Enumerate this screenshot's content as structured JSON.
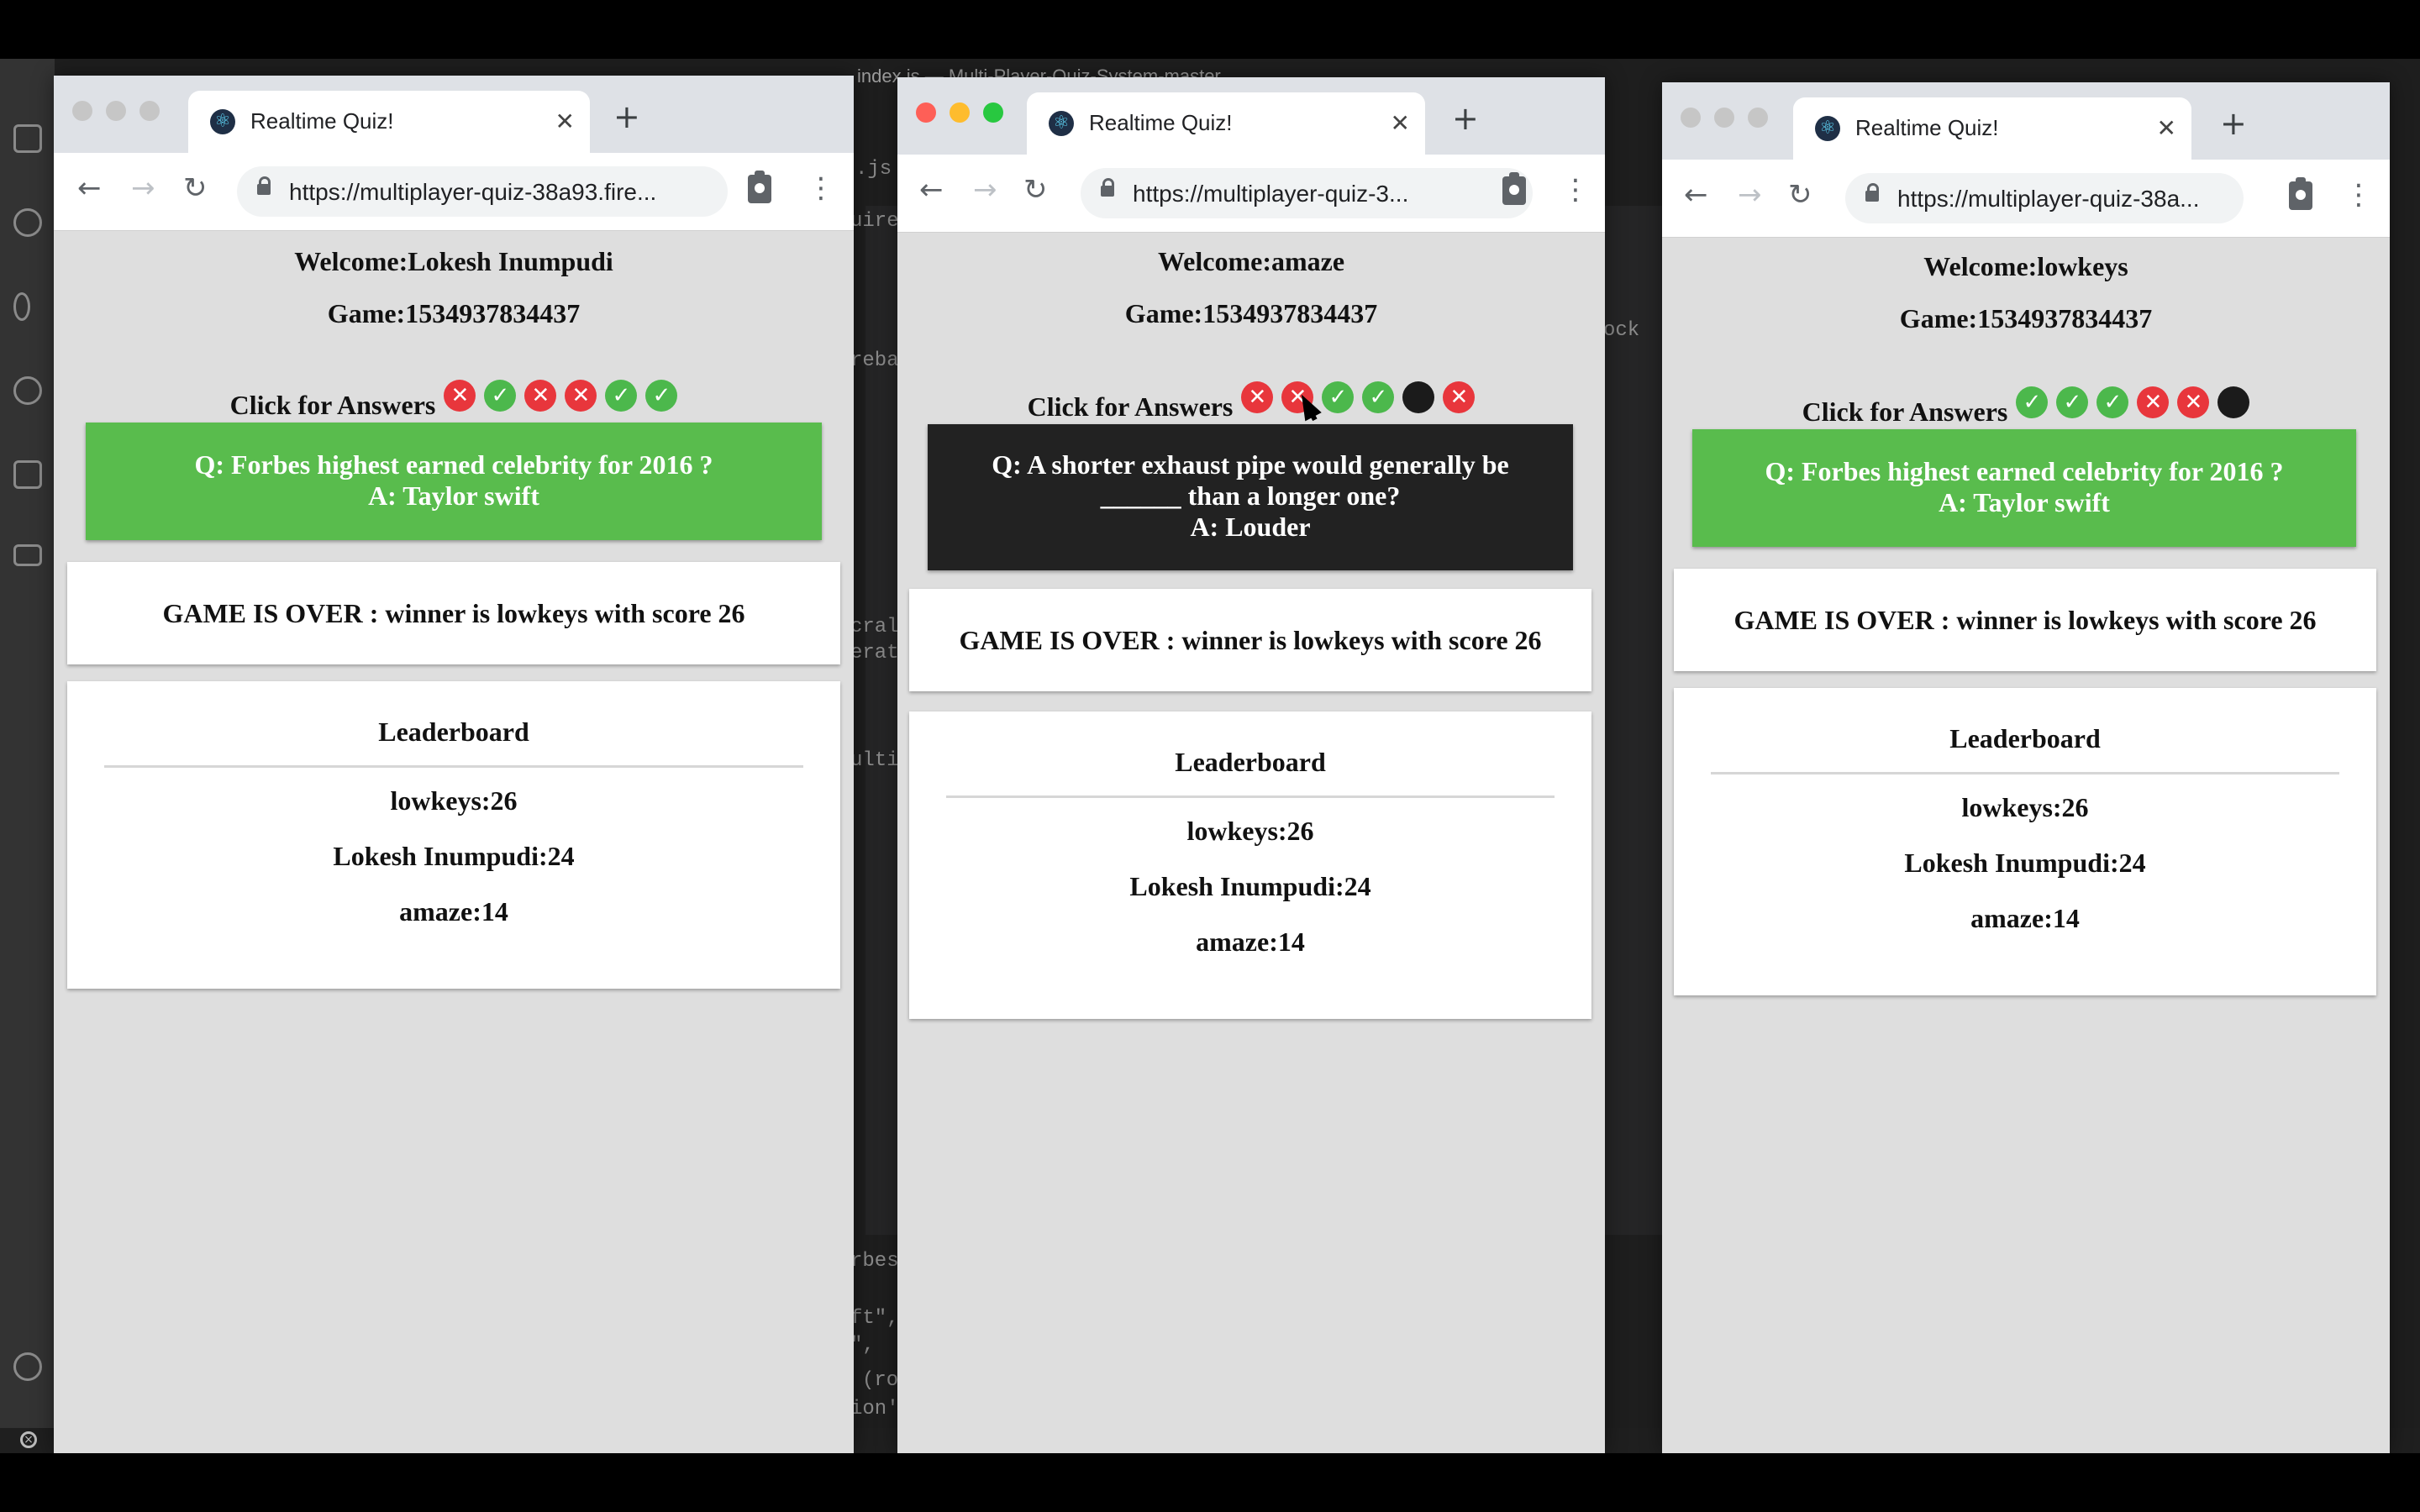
{
  "editor": {
    "title": "index.js — Multi-Player-Quiz-System-master",
    "code_fragments": [
      ".js",
      "uire",
      "reba",
      "ock",
      "cral",
      "erat",
      "ulti",
      "rbes",
      "ft\",",
      "\",",
      "(ro",
      "ion'"
    ]
  },
  "windows": [
    {
      "tab_title": "Realtime Quiz!",
      "url": "https://multiplayer-quiz-38a93.fire...",
      "welcome": "Welcome:Lokesh Inumpudi",
      "game": "Game:1534937834437",
      "answers_label": "Click for Answers",
      "answers": [
        "wrong",
        "right",
        "wrong",
        "wrong",
        "right",
        "right"
      ],
      "question": "Q: Forbes highest earned celebrity for 2016 ?",
      "question_cont": "",
      "answer": "A: Taylor swift",
      "question_color": "#59bc4d",
      "game_over": "GAME IS OVER : winner is lowkeys with score 26",
      "leaderboard_title": "Leaderboard",
      "leaderboard": [
        "lowkeys:26",
        "Lokesh Inumpudi:24",
        "amaze:14"
      ]
    },
    {
      "tab_title": "Realtime Quiz!",
      "url": "https://multiplayer-quiz-3...",
      "welcome": "Welcome:amaze",
      "game": "Game:1534937834437",
      "answers_label": "Click for Answers",
      "answers": [
        "wrong",
        "wrong",
        "right",
        "right",
        "none",
        "wrong"
      ],
      "question": "Q: A shorter exhaust pipe would generally be",
      "question_cont": "______ than a longer one?",
      "answer": "A: Louder",
      "question_color": "#222222",
      "game_over": "GAME IS OVER : winner is lowkeys with score 26",
      "leaderboard_title": "Leaderboard",
      "leaderboard": [
        "lowkeys:26",
        "Lokesh Inumpudi:24",
        "amaze:14"
      ]
    },
    {
      "tab_title": "Realtime Quiz!",
      "url": "https://multiplayer-quiz-38a...",
      "welcome": "Welcome:lowkeys",
      "game": "Game:1534937834437",
      "answers_label": "Click for Answers",
      "answers": [
        "right",
        "right",
        "right",
        "wrong",
        "wrong",
        "none"
      ],
      "question": "Q: Forbes highest earned celebrity for 2016 ?",
      "question_cont": "",
      "answer": "A: Taylor swift",
      "question_color": "#59bc4d",
      "game_over": "GAME IS OVER : winner is lowkeys with score 26",
      "leaderboard_title": "Leaderboard",
      "leaderboard": [
        "lowkeys:26",
        "Lokesh Inumpudi:24",
        "amaze:14"
      ]
    }
  ],
  "icons": {
    "answer_glyphs": {
      "wrong": "✕",
      "right": "✓",
      "none": ""
    },
    "back": "←",
    "forward": "→",
    "reload": "↻",
    "tab_close": "✕",
    "new_tab": "+",
    "menu": "⋮",
    "favicon": "⚛"
  }
}
